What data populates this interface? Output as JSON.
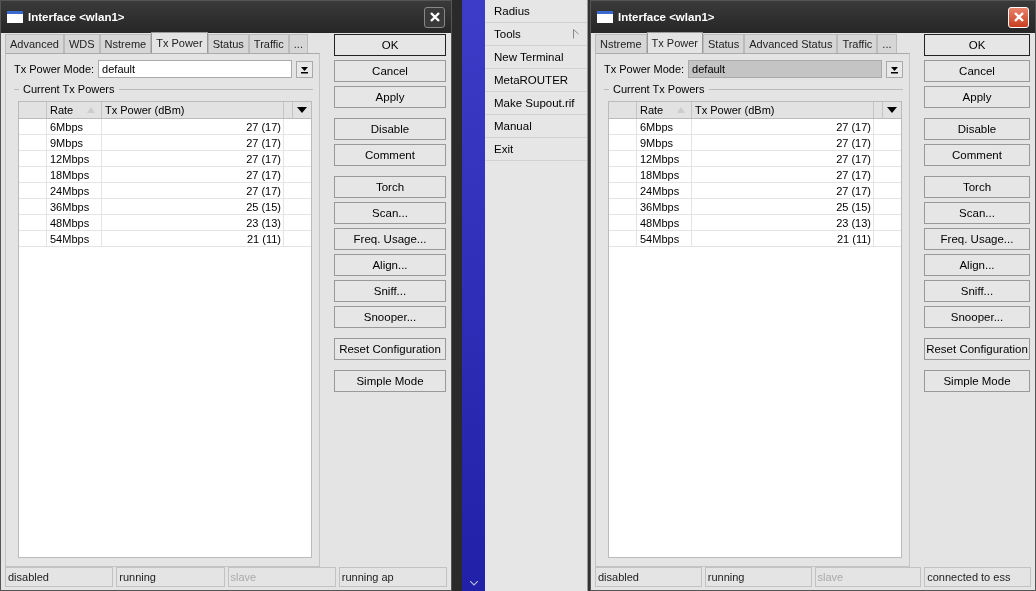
{
  "windows": [
    {
      "title": "Interface <wlan1>",
      "close_button": {
        "kind": "plain"
      },
      "tabs": [
        {
          "label": "Advanced",
          "selected": false
        },
        {
          "label": "WDS",
          "selected": false
        },
        {
          "label": "Nstreme",
          "selected": false
        },
        {
          "label": "Tx Power",
          "selected": true
        },
        {
          "label": "Status",
          "selected": false
        },
        {
          "label": "Traffic",
          "selected": false
        },
        {
          "label": "...",
          "selected": false
        }
      ],
      "mode": {
        "label": "Tx Power Mode:",
        "value": "default",
        "disabled": false
      },
      "group_title": "Current Tx Powers",
      "columns": [
        "Rate",
        "Tx Power (dBm)"
      ],
      "rows": [
        [
          "6Mbps",
          "27 (17)"
        ],
        [
          "9Mbps",
          "27 (17)"
        ],
        [
          "12Mbps",
          "27 (17)"
        ],
        [
          "18Mbps",
          "27 (17)"
        ],
        [
          "24Mbps",
          "27 (17)"
        ],
        [
          "36Mbps",
          "25 (15)"
        ],
        [
          "48Mbps",
          "23 (13)"
        ],
        [
          "54Mbps",
          "21 (11)"
        ]
      ],
      "button_groups": [
        [
          "OK",
          "Cancel",
          "Apply"
        ],
        [
          "Disable",
          "Comment"
        ],
        [
          "Torch",
          "Scan...",
          "Freq. Usage...",
          "Align...",
          "Sniff...",
          "Snooper..."
        ],
        [
          "Reset Configuration"
        ],
        [
          "Simple Mode"
        ]
      ],
      "status": [
        {
          "text": "disabled",
          "disabled": false
        },
        {
          "text": "running",
          "disabled": false
        },
        {
          "text": "slave",
          "disabled": true
        },
        {
          "text": "running ap",
          "disabled": false
        }
      ]
    },
    {
      "title": "Interface <wlan1>",
      "close_button": {
        "kind": "red"
      },
      "tabs": [
        {
          "label": "Nstreme",
          "selected": false
        },
        {
          "label": "Tx Power",
          "selected": true
        },
        {
          "label": "Status",
          "selected": false
        },
        {
          "label": "Advanced Status",
          "selected": false
        },
        {
          "label": "Traffic",
          "selected": false
        },
        {
          "label": "...",
          "selected": false
        }
      ],
      "mode": {
        "label": "Tx Power Mode:",
        "value": "default",
        "disabled": true
      },
      "group_title": "Current Tx Powers",
      "columns": [
        "Rate",
        "Tx Power (dBm)"
      ],
      "rows": [
        [
          "6Mbps",
          "27 (17)"
        ],
        [
          "9Mbps",
          "27 (17)"
        ],
        [
          "12Mbps",
          "27 (17)"
        ],
        [
          "18Mbps",
          "27 (17)"
        ],
        [
          "24Mbps",
          "27 (17)"
        ],
        [
          "36Mbps",
          "25 (15)"
        ],
        [
          "48Mbps",
          "23 (13)"
        ],
        [
          "54Mbps",
          "21 (11)"
        ]
      ],
      "button_groups": [
        [
          "OK",
          "Cancel",
          "Apply"
        ],
        [
          "Disable",
          "Comment"
        ],
        [
          "Torch",
          "Scan...",
          "Freq. Usage...",
          "Align...",
          "Sniff...",
          "Snooper..."
        ],
        [
          "Reset Configuration"
        ],
        [
          "Simple Mode"
        ]
      ],
      "status": [
        {
          "text": "disabled",
          "disabled": false
        },
        {
          "text": "running",
          "disabled": false
        },
        {
          "text": "slave",
          "disabled": true
        },
        {
          "text": "connected to ess",
          "disabled": false
        }
      ]
    }
  ],
  "menu": {
    "items": [
      {
        "label": "Radius",
        "submenu": false
      },
      {
        "label": "Tools",
        "submenu": true
      },
      {
        "label": "New Terminal",
        "submenu": false
      },
      {
        "label": "MetaROUTER",
        "submenu": false
      },
      {
        "label": "Make Supout.rif",
        "submenu": false
      },
      {
        "label": "Manual",
        "submenu": false
      },
      {
        "label": "Exit",
        "submenu": false
      }
    ]
  }
}
